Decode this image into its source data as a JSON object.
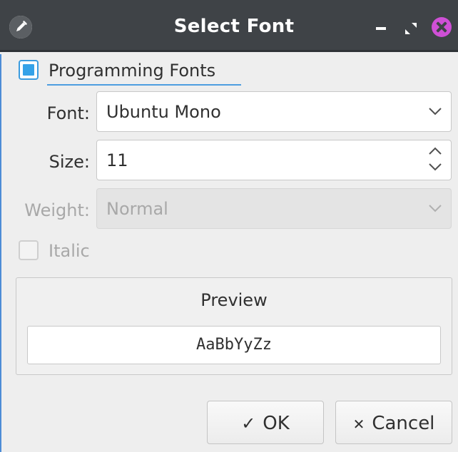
{
  "window": {
    "title": "Select Font"
  },
  "programming_fonts": {
    "label": "Programming Fonts",
    "checked": true
  },
  "font": {
    "label": "Font:",
    "value": "Ubuntu Mono"
  },
  "size": {
    "label": "Size:",
    "value": "11"
  },
  "weight": {
    "label": "Weight:",
    "value": "Normal",
    "enabled": false
  },
  "italic": {
    "label": "Italic",
    "checked": false,
    "enabled": false
  },
  "preview": {
    "title": "Preview",
    "sample": "AaBbYyZz"
  },
  "buttons": {
    "ok_label": "OK",
    "ok_icon": "check-icon",
    "cancel_label": "Cancel",
    "cancel_icon": "x-icon"
  },
  "colors": {
    "titlebar": "#3f4347",
    "accent": "#35a2e8",
    "close": "#cf50d6"
  }
}
